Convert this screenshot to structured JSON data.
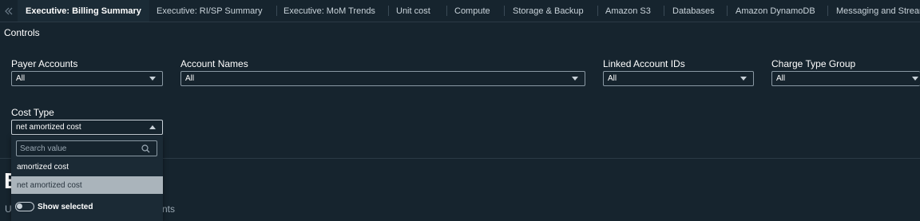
{
  "tabs": [
    {
      "label": "Executive: Billing Summary",
      "active": true
    },
    {
      "label": "Executive: RI/SP Summary"
    },
    {
      "label": "Executive: MoM Trends"
    },
    {
      "label": "Unit cost"
    },
    {
      "label": "Compute"
    },
    {
      "label": "Storage & Backup"
    },
    {
      "label": "Amazon S3"
    },
    {
      "label": "Databases"
    },
    {
      "label": "Amazon DynamoDB"
    },
    {
      "label": "Messaging and Streaming"
    }
  ],
  "controls": {
    "section_label": "Controls",
    "payer_accounts": {
      "label": "Payer Accounts",
      "value": "All"
    },
    "account_names": {
      "label": "Account Names",
      "value": "All"
    },
    "linked_account_ids": {
      "label": "Linked Account IDs",
      "value": "All"
    },
    "charge_type_group": {
      "label": "Charge Type Group",
      "value": "All"
    },
    "cost_type": {
      "label": "Cost Type",
      "value": "net amortized cost"
    }
  },
  "dropdown": {
    "search_placeholder": "Search value",
    "options": [
      "amortized cost",
      "net amortized cost"
    ],
    "toggle_label": "Show selected"
  },
  "below": {
    "title_fragment": "B",
    "subtitle_left": "U",
    "subtitle_right": "nts"
  },
  "colors": {
    "background": "#16242e",
    "selected_option": "#aab4bb"
  }
}
